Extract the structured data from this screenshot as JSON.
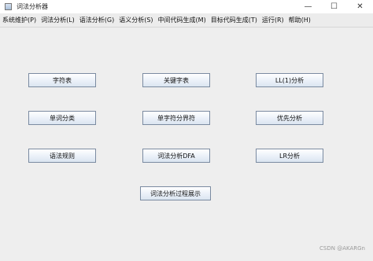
{
  "window": {
    "title": "词法分析器",
    "controls": {
      "minimize": "—",
      "maximize": "☐",
      "close": "✕"
    }
  },
  "menu": [
    "系统维护(P)",
    "词法分析(L)",
    "语法分析(G)",
    "语义分析(S)",
    "中间代码生成(M)",
    "目标代码生成(T)",
    "运行(R)",
    "帮助(H)"
  ],
  "buttons": {
    "char_table": "字符表",
    "keyword_table": "关键字表",
    "ll1_analysis": "LL(1)分析",
    "word_classify": "单词分类",
    "single_char_delim": "单字符分界符",
    "precedence_analysis": "优先分析",
    "grammar_rules": "语法规则",
    "lexical_dfa": "词法分析DFA",
    "lr_analysis": "LR分析",
    "process_display": "词法分析过程展示"
  },
  "watermark": "CSDN @AKARGn"
}
